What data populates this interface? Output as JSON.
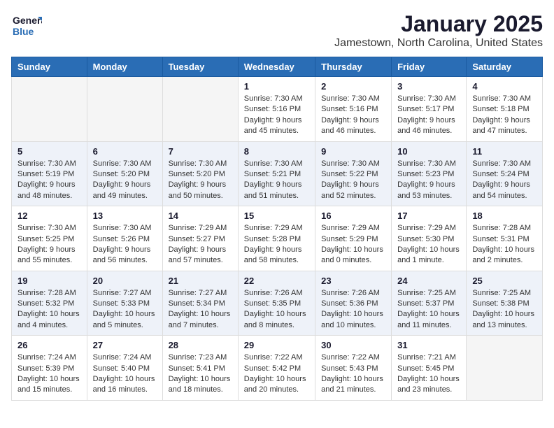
{
  "header": {
    "logo_general": "General",
    "logo_blue": "Blue",
    "title": "January 2025",
    "subtitle": "Jamestown, North Carolina, United States"
  },
  "calendar": {
    "days_of_week": [
      "Sunday",
      "Monday",
      "Tuesday",
      "Wednesday",
      "Thursday",
      "Friday",
      "Saturday"
    ],
    "weeks": [
      [
        {
          "day": "",
          "info": ""
        },
        {
          "day": "",
          "info": ""
        },
        {
          "day": "",
          "info": ""
        },
        {
          "day": "1",
          "info": "Sunrise: 7:30 AM\nSunset: 5:16 PM\nDaylight: 9 hours\nand 45 minutes."
        },
        {
          "day": "2",
          "info": "Sunrise: 7:30 AM\nSunset: 5:16 PM\nDaylight: 9 hours\nand 46 minutes."
        },
        {
          "day": "3",
          "info": "Sunrise: 7:30 AM\nSunset: 5:17 PM\nDaylight: 9 hours\nand 46 minutes."
        },
        {
          "day": "4",
          "info": "Sunrise: 7:30 AM\nSunset: 5:18 PM\nDaylight: 9 hours\nand 47 minutes."
        }
      ],
      [
        {
          "day": "5",
          "info": "Sunrise: 7:30 AM\nSunset: 5:19 PM\nDaylight: 9 hours\nand 48 minutes."
        },
        {
          "day": "6",
          "info": "Sunrise: 7:30 AM\nSunset: 5:20 PM\nDaylight: 9 hours\nand 49 minutes."
        },
        {
          "day": "7",
          "info": "Sunrise: 7:30 AM\nSunset: 5:20 PM\nDaylight: 9 hours\nand 50 minutes."
        },
        {
          "day": "8",
          "info": "Sunrise: 7:30 AM\nSunset: 5:21 PM\nDaylight: 9 hours\nand 51 minutes."
        },
        {
          "day": "9",
          "info": "Sunrise: 7:30 AM\nSunset: 5:22 PM\nDaylight: 9 hours\nand 52 minutes."
        },
        {
          "day": "10",
          "info": "Sunrise: 7:30 AM\nSunset: 5:23 PM\nDaylight: 9 hours\nand 53 minutes."
        },
        {
          "day": "11",
          "info": "Sunrise: 7:30 AM\nSunset: 5:24 PM\nDaylight: 9 hours\nand 54 minutes."
        }
      ],
      [
        {
          "day": "12",
          "info": "Sunrise: 7:30 AM\nSunset: 5:25 PM\nDaylight: 9 hours\nand 55 minutes."
        },
        {
          "day": "13",
          "info": "Sunrise: 7:30 AM\nSunset: 5:26 PM\nDaylight: 9 hours\nand 56 minutes."
        },
        {
          "day": "14",
          "info": "Sunrise: 7:29 AM\nSunset: 5:27 PM\nDaylight: 9 hours\nand 57 minutes."
        },
        {
          "day": "15",
          "info": "Sunrise: 7:29 AM\nSunset: 5:28 PM\nDaylight: 9 hours\nand 58 minutes."
        },
        {
          "day": "16",
          "info": "Sunrise: 7:29 AM\nSunset: 5:29 PM\nDaylight: 10 hours\nand 0 minutes."
        },
        {
          "day": "17",
          "info": "Sunrise: 7:29 AM\nSunset: 5:30 PM\nDaylight: 10 hours\nand 1 minute."
        },
        {
          "day": "18",
          "info": "Sunrise: 7:28 AM\nSunset: 5:31 PM\nDaylight: 10 hours\nand 2 minutes."
        }
      ],
      [
        {
          "day": "19",
          "info": "Sunrise: 7:28 AM\nSunset: 5:32 PM\nDaylight: 10 hours\nand 4 minutes."
        },
        {
          "day": "20",
          "info": "Sunrise: 7:27 AM\nSunset: 5:33 PM\nDaylight: 10 hours\nand 5 minutes."
        },
        {
          "day": "21",
          "info": "Sunrise: 7:27 AM\nSunset: 5:34 PM\nDaylight: 10 hours\nand 7 minutes."
        },
        {
          "day": "22",
          "info": "Sunrise: 7:26 AM\nSunset: 5:35 PM\nDaylight: 10 hours\nand 8 minutes."
        },
        {
          "day": "23",
          "info": "Sunrise: 7:26 AM\nSunset: 5:36 PM\nDaylight: 10 hours\nand 10 minutes."
        },
        {
          "day": "24",
          "info": "Sunrise: 7:25 AM\nSunset: 5:37 PM\nDaylight: 10 hours\nand 11 minutes."
        },
        {
          "day": "25",
          "info": "Sunrise: 7:25 AM\nSunset: 5:38 PM\nDaylight: 10 hours\nand 13 minutes."
        }
      ],
      [
        {
          "day": "26",
          "info": "Sunrise: 7:24 AM\nSunset: 5:39 PM\nDaylight: 10 hours\nand 15 minutes."
        },
        {
          "day": "27",
          "info": "Sunrise: 7:24 AM\nSunset: 5:40 PM\nDaylight: 10 hours\nand 16 minutes."
        },
        {
          "day": "28",
          "info": "Sunrise: 7:23 AM\nSunset: 5:41 PM\nDaylight: 10 hours\nand 18 minutes."
        },
        {
          "day": "29",
          "info": "Sunrise: 7:22 AM\nSunset: 5:42 PM\nDaylight: 10 hours\nand 20 minutes."
        },
        {
          "day": "30",
          "info": "Sunrise: 7:22 AM\nSunset: 5:43 PM\nDaylight: 10 hours\nand 21 minutes."
        },
        {
          "day": "31",
          "info": "Sunrise: 7:21 AM\nSunset: 5:45 PM\nDaylight: 10 hours\nand 23 minutes."
        },
        {
          "day": "",
          "info": ""
        }
      ]
    ]
  }
}
